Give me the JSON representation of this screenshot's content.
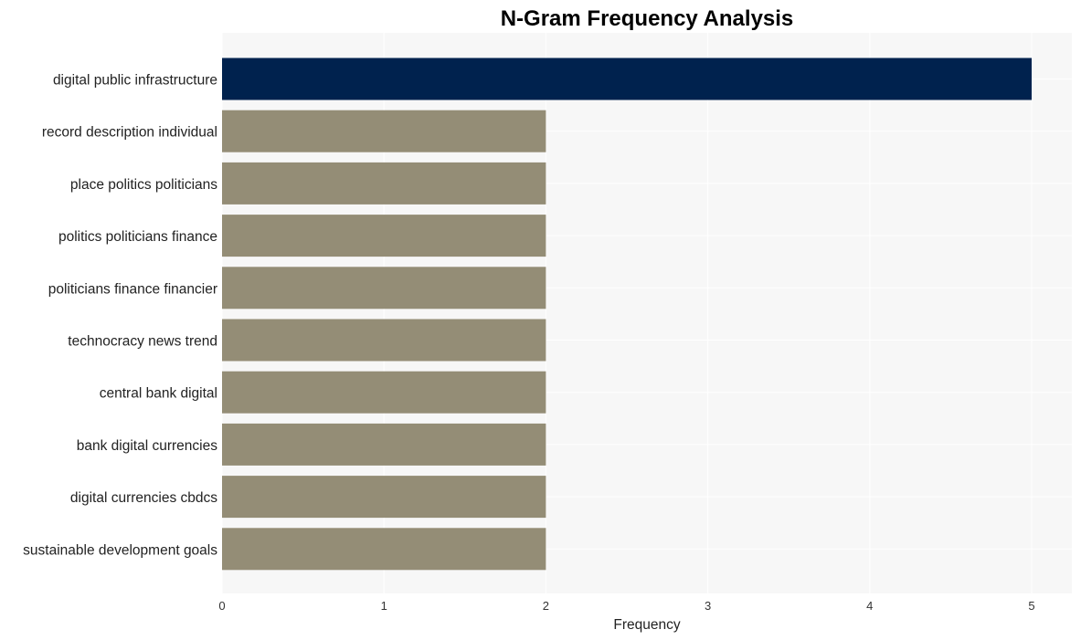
{
  "chart_data": {
    "type": "bar",
    "orientation": "horizontal",
    "title": "N-Gram Frequency Analysis",
    "xlabel": "Frequency",
    "ylabel": "",
    "xlim": [
      0,
      5.25
    ],
    "xticks": [
      0,
      1,
      2,
      3,
      4,
      5
    ],
    "grid": true,
    "legend": "none",
    "categories": [
      "digital public infrastructure",
      "record description individual",
      "place politics politicians",
      "politics politicians finance",
      "politicians finance financier",
      "technocracy news trend",
      "central bank digital",
      "bank digital currencies",
      "digital currencies cbdcs",
      "sustainable development goals"
    ],
    "values": [
      5,
      2,
      2,
      2,
      2,
      2,
      2,
      2,
      2,
      2
    ],
    "colors": {
      "highlight": "#00224e",
      "default": "#948d76",
      "plot_background": "#f7f7f7",
      "grid": "#ffffff"
    }
  }
}
